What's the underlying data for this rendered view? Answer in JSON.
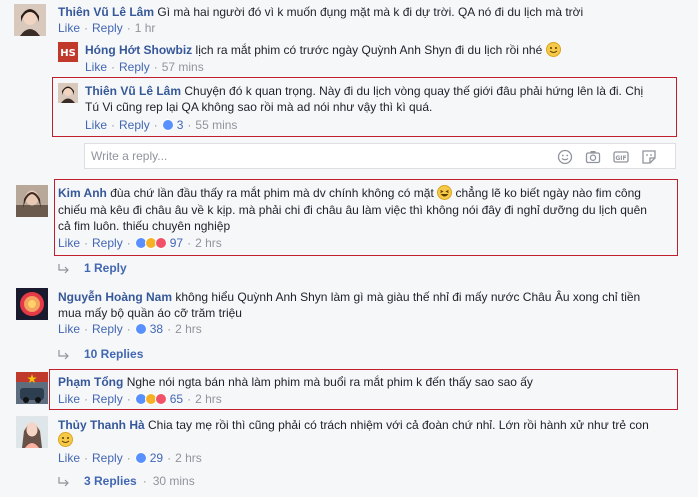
{
  "actions": {
    "like": "Like",
    "reply": "Reply",
    "dot": "·"
  },
  "comments": [
    {
      "name": "Thiên Vũ Lê Lâm",
      "text": "Gì mà hai người đó vì k muốn đụng mặt mà k đi dự trời. QA nó đi du lịch mà trời",
      "time": "1 hr"
    },
    {
      "name": "Hóng Hớt Showbiz",
      "text": "lịch ra mắt phim có trước ngày Quỳnh Anh Shyn đi du lịch rồi nhé",
      "time": "57 mins"
    },
    {
      "name": "Thiên Vũ Lê Lâm",
      "text_line1": "Chuyện đó k quan trọng. Này đi du lịch vòng quay thế giới đâu phải hứng lên là đi. Chị",
      "text_line2": "Tú Vi cũng rep lại QA không sao rồi mà ad nói như vậy thì kì quá.",
      "reactions": "3",
      "time": "55 mins"
    },
    {
      "name": "Kim Anh",
      "text_line1": "đùa chứ lần đầu thấy ra mắt phim mà dv chính không có mặt",
      "text_line1b": "chẳng lẽ ko biết ngày nào fim công",
      "text_line2": "chiếu mà kêu đi châu âu về k kịp. mà phải chi đi châu âu làm việc thì không nói đây đi nghỉ dưỡng du lịch quên",
      "text_line3": "cả fim luôn. thiếu chuyên nghiệp",
      "reactions": "97",
      "time": "2 hrs"
    },
    {
      "name": "Nguyễn Hoàng Nam",
      "text_line1": "không hiểu Quỳnh Anh Shyn làm gì mà giàu thế nhỉ đi mấy nước Châu Âu xong chỉ tiền",
      "text_line2": "mua mấy bộ quần áo cỡ trăm triệu",
      "reactions": "38",
      "time": "2 hrs"
    },
    {
      "name": "Phạm Tổng",
      "text": "Nghe nói ngta bán nhà làm phim mà buổi ra mắt phim k đến thấy sao sao ấy",
      "reactions": "65",
      "time": "2 hrs"
    },
    {
      "name": "Thủy Thanh Hà",
      "text": "Chia tay mẹ rồi thì cũng phải có trách nhiệm với cả đoàn chứ nhỉ. Lớn rồi hành xử như trẻ con",
      "reactions": "29",
      "time": "2 hrs"
    }
  ],
  "reply_box": {
    "placeholder": "Write a reply..."
  },
  "reply_links": [
    {
      "label": "1 Reply"
    },
    {
      "label": "10 Replies"
    },
    {
      "label": "3 Replies",
      "time": "30 mins"
    }
  ]
}
